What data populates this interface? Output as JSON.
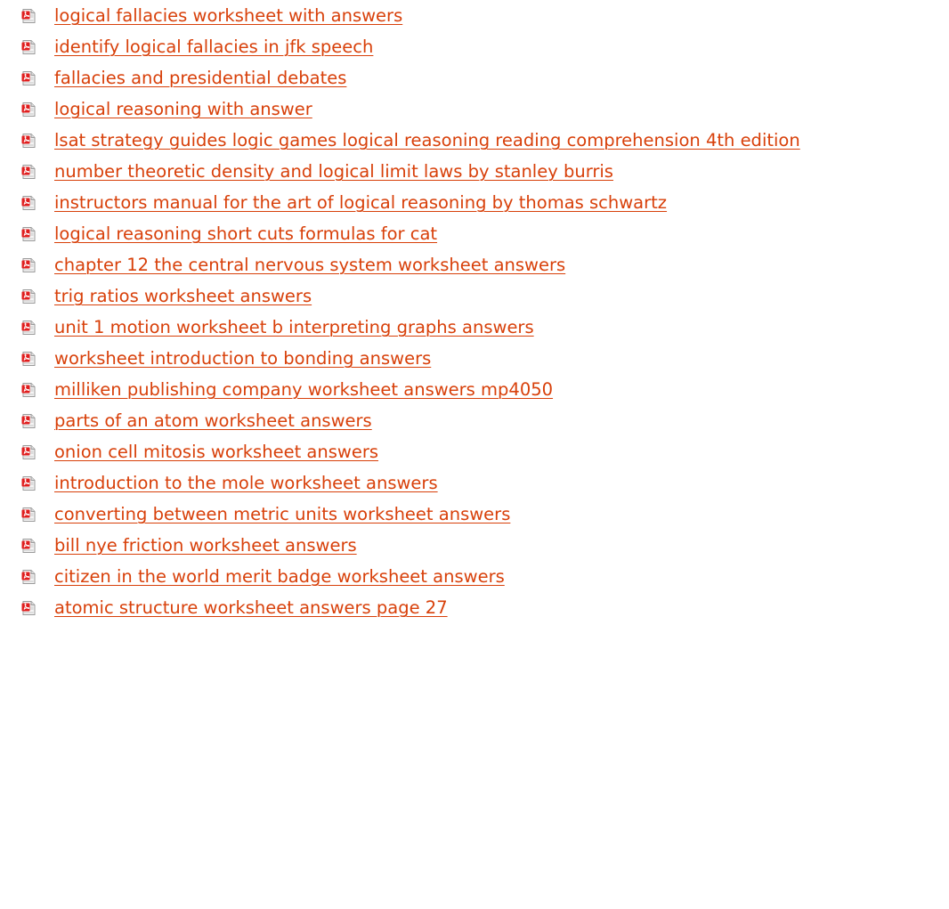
{
  "theme": {
    "link_color": "#d8400a",
    "icon_name": "pdf-file-icon",
    "icon_red": "#e01e1e"
  },
  "links": [
    "logical fallacies worksheet with answers",
    "identify logical fallacies in jfk speech",
    "fallacies and presidential debates",
    "logical reasoning with answer",
    "lsat strategy guides logic games logical reasoning reading comprehension 4th edition",
    "number theoretic density and logical limit laws by stanley burris",
    "instructors manual for the art of logical reasoning by thomas schwartz",
    "logical reasoning short cuts formulas for cat",
    "chapter 12 the central nervous system worksheet answers",
    "trig ratios worksheet answers",
    "unit 1 motion worksheet b interpreting graphs answers",
    "worksheet introduction to bonding answers",
    "milliken publishing company worksheet answers mp4050",
    "parts of an atom worksheet answers",
    "onion cell mitosis worksheet answers",
    "introduction to the mole worksheet answers",
    "converting between metric units worksheet answers",
    "bill nye friction worksheet answers",
    "citizen in the world merit badge worksheet answers",
    "atomic structure worksheet answers page 27"
  ]
}
